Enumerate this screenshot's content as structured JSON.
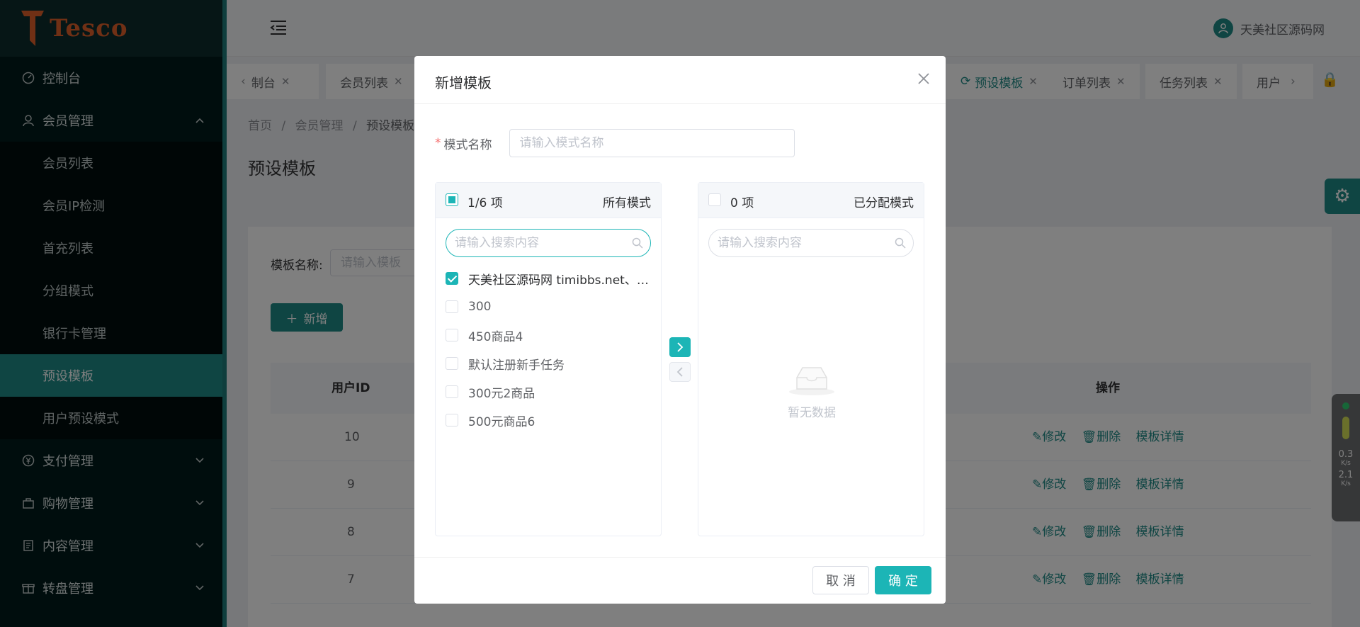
{
  "app": {
    "brand": "Tesco",
    "user_name": "天美社区源码网"
  },
  "sidebar": {
    "items": [
      {
        "label": "控制台",
        "icon": "dashboard-icon"
      },
      {
        "label": "会员管理",
        "icon": "user-icon",
        "expanded": true
      },
      {
        "label": "支付管理",
        "icon": "yen-icon"
      },
      {
        "label": "购物管理",
        "icon": "bag-icon"
      },
      {
        "label": "内容管理",
        "icon": "document-icon"
      },
      {
        "label": "转盘管理",
        "icon": "gift-icon"
      }
    ],
    "submenu": [
      {
        "label": "会员列表"
      },
      {
        "label": "会员IP检测"
      },
      {
        "label": "首充列表"
      },
      {
        "label": "分组模式"
      },
      {
        "label": "银行卡管理"
      },
      {
        "label": "预设模板",
        "active": true
      },
      {
        "label": "用户预设模式"
      }
    ]
  },
  "tabs": [
    {
      "label": "制台"
    },
    {
      "label": "会员列表"
    },
    {
      "label": "预设模板",
      "active": true
    },
    {
      "label": "订单列表"
    },
    {
      "label": "任务列表"
    },
    {
      "label": "用户"
    }
  ],
  "breadcrumb": [
    "首页",
    "会员管理",
    "预设模板"
  ],
  "page": {
    "title": "预设模板",
    "filter_label": "模板名称:",
    "filter_placeholder": "请输入模板",
    "add_label": "新增"
  },
  "table": {
    "columns": [
      "用户ID",
      "操作"
    ],
    "rows": [
      {
        "id": "10"
      },
      {
        "id": "9"
      },
      {
        "id": "8"
      },
      {
        "id": "7"
      }
    ],
    "actions": {
      "edit": "修改",
      "delete": "删除",
      "detail": "模板详情"
    }
  },
  "network": {
    "up": "0.3",
    "down": "2.1",
    "unit": "K/s"
  },
  "dialog": {
    "title": "新增模板",
    "name_label": "模式名称",
    "name_placeholder": "请输入模式名称",
    "left_panel": {
      "count": "1/6 项",
      "title": "所有模式",
      "search_placeholder": "请输入搜索内容",
      "items": [
        {
          "label": "天美社区源码网 timibbs.net、timibbs.com、timibbs.cc",
          "checked": true
        },
        {
          "label": "300",
          "checked": false
        },
        {
          "label": "450商品4",
          "checked": false
        },
        {
          "label": "默认注册新手任务",
          "checked": false
        },
        {
          "label": "300元2商品",
          "checked": false
        },
        {
          "label": "500元商品6",
          "checked": false
        }
      ]
    },
    "right_panel": {
      "count": "0 项",
      "title": "已分配模式",
      "search_placeholder": "请输入搜索内容",
      "empty_text": "暂无数据"
    },
    "cancel_label": "取 消",
    "confirm_label": "确 定"
  },
  "colors": {
    "accent": "#1cb5b6",
    "sidebar_active": "#1e8a87"
  }
}
